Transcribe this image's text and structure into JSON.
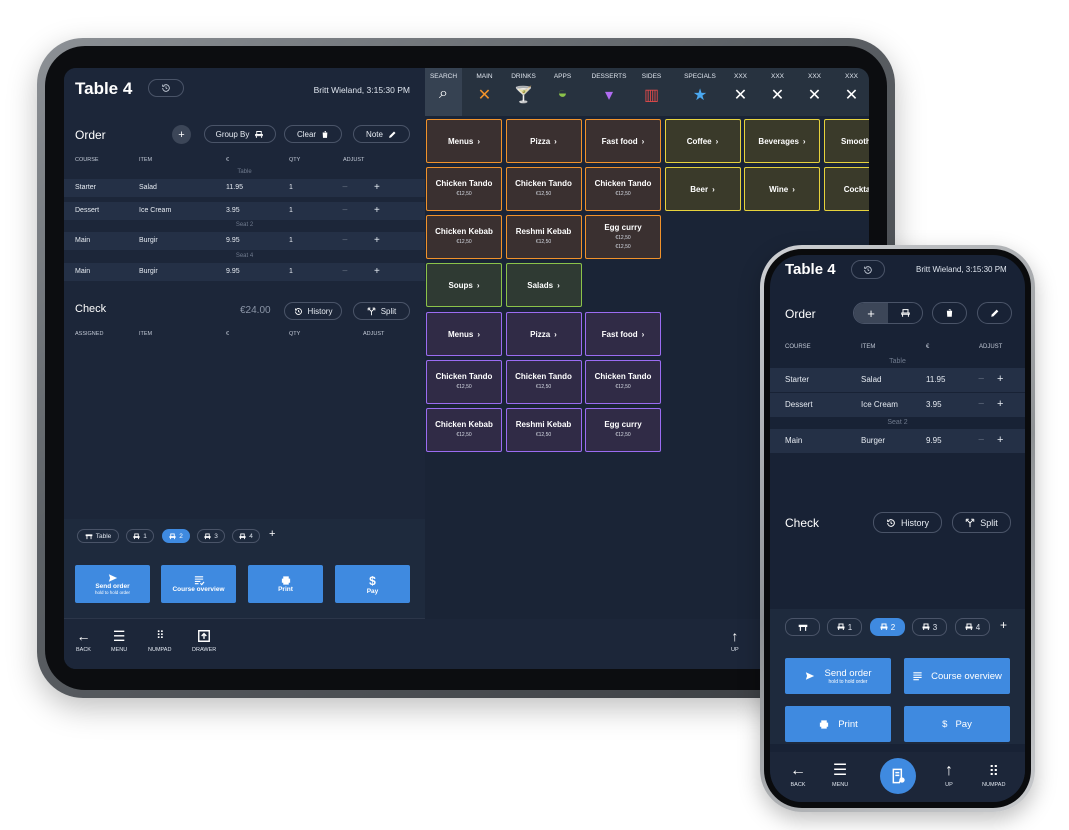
{
  "tablet": {
    "title": "Table 4",
    "user": "Britt Wieland, 3:15:30 PM",
    "order": {
      "title": "Order",
      "group_by": "Group By",
      "clear": "Clear",
      "note": "Note",
      "headers": [
        "COURSE",
        "ITEM",
        "€",
        "QTY",
        "ADJUST"
      ],
      "sections": [
        {
          "label": "Table",
          "rows": [
            {
              "course": "Starter",
              "item": "Salad",
              "price": "11.95",
              "qty": "1"
            },
            {
              "course": "Dessert",
              "item": "Ice Cream",
              "price": "3.95",
              "qty": "1"
            }
          ]
        },
        {
          "label": "Seat 2",
          "rows": [
            {
              "course": "Main",
              "item": "Burgir",
              "price": "9.95",
              "qty": "1"
            }
          ]
        },
        {
          "label": "Seat 4",
          "rows": [
            {
              "course": "Main",
              "item": "Burgir",
              "price": "9.95",
              "qty": "1"
            }
          ]
        }
      ]
    },
    "check": {
      "title": "Check",
      "total": "€24.00",
      "history": "History",
      "split": "Split",
      "headers": [
        "ASSIGNED",
        "ITEM",
        "€",
        "QTY",
        "ADJUST"
      ]
    },
    "seats": [
      "Table",
      "1",
      "2",
      "3",
      "4"
    ],
    "actions": {
      "send": "Send order",
      "send_sub": "hold to hold order",
      "course": "Course overview",
      "print": "Print",
      "pay": "Pay"
    },
    "nav": {
      "back": "BACK",
      "menu": "MENU",
      "numpad": "NUMPAD",
      "drawer": "DRAWER",
      "up": "UP"
    },
    "categories": [
      "SEARCH",
      "MAIN",
      "DRINKS",
      "APPS",
      "DESSERTS",
      "SIDES",
      "SPECIALS",
      "XXX",
      "XXX",
      "XXX",
      "XXX"
    ],
    "tiles": [
      [
        {
          "label": "Menus",
          "arrow": true,
          "c": "o"
        },
        {
          "label": "Pizza",
          "arrow": true,
          "c": "o"
        },
        {
          "label": "Fast food",
          "arrow": true,
          "c": "o"
        },
        {
          "label": "Coffee",
          "arrow": true,
          "c": "y"
        },
        {
          "label": "Beverages",
          "arrow": true,
          "c": "y"
        },
        {
          "label": "Smoothies",
          "arrow": false,
          "c": "y"
        }
      ],
      [
        {
          "label": "Chicken Tando",
          "price": "€12,50",
          "c": "o"
        },
        {
          "label": "Chicken Tando",
          "price": "€12,50",
          "c": "o"
        },
        {
          "label": "Chicken Tando",
          "price": "€12,50",
          "c": "o"
        },
        {
          "label": "Beer",
          "arrow": true,
          "c": "y"
        },
        {
          "label": "Wine",
          "arrow": true,
          "c": "y"
        },
        {
          "label": "Cocktails",
          "arrow": false,
          "c": "y"
        }
      ],
      [
        {
          "label": "Chicken Kebab",
          "price": "€12,50",
          "c": "o"
        },
        {
          "label": "Reshmi Kebab",
          "price": "€12,50",
          "c": "o"
        },
        {
          "label": "Egg curry",
          "price": "€12,50",
          "price2": "€12,50",
          "c": "o"
        }
      ],
      [
        {
          "label": "Soups",
          "arrow": true,
          "c": "g"
        },
        {
          "label": "Salads",
          "arrow": true,
          "c": "g"
        }
      ],
      [
        {
          "label": "Menus",
          "arrow": true,
          "c": "p"
        },
        {
          "label": "Pizza",
          "arrow": true,
          "c": "p"
        },
        {
          "label": "Fast food",
          "arrow": true,
          "c": "p"
        }
      ],
      [
        {
          "label": "Chicken Tando",
          "price": "€12,50",
          "c": "p"
        },
        {
          "label": "Chicken Tando",
          "price": "€12,50",
          "c": "p"
        },
        {
          "label": "Chicken Tando",
          "price": "€12,50",
          "c": "p"
        }
      ],
      [
        {
          "label": "Chicken Kebab",
          "price": "€12,50",
          "c": "p"
        },
        {
          "label": "Reshmi Kebab",
          "price": "€12,50",
          "c": "p"
        },
        {
          "label": "Egg curry",
          "price": "€12,50",
          "c": "p"
        }
      ]
    ]
  },
  "phone": {
    "title": "Table 4",
    "user": "Britt Wieland, 3:15:30 PM",
    "order_title": "Order",
    "headers": [
      "COURSE",
      "ITEM",
      "€",
      "ADJUST"
    ],
    "sections": [
      {
        "label": "Table",
        "rows": [
          {
            "course": "Starter",
            "item": "Salad",
            "price": "11.95"
          },
          {
            "course": "Dessert",
            "item": "Ice Cream",
            "price": "3.95"
          }
        ]
      },
      {
        "label": "Seat 2",
        "rows": [
          {
            "course": "Main",
            "item": "Burger",
            "price": "9.95"
          }
        ]
      }
    ],
    "check_title": "Check",
    "history": "History",
    "split": "Split",
    "seats": [
      "1",
      "2",
      "3",
      "4"
    ],
    "send": "Send order",
    "send_sub": "hold to hold order",
    "course": "Course overview",
    "print": "Print",
    "pay": "Pay",
    "nav": {
      "back": "BACK",
      "menu": "MENU",
      "up": "UP",
      "numpad": "NUMPAD"
    }
  },
  "colors": {
    "accent": "#3f8ae0",
    "orange": "#f0922b",
    "yellow": "#e6d23c",
    "green": "#8bc34a",
    "purple": "#9b6cf2"
  }
}
